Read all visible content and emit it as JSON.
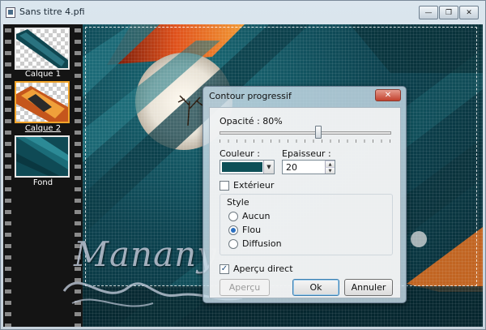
{
  "window": {
    "title": "Sans titre 4.pfi",
    "buttons": {
      "minimize": "—",
      "restore": "❐",
      "close": "✕"
    }
  },
  "layers": [
    {
      "label": "Calque 1",
      "selected": false
    },
    {
      "label": "Calque 2",
      "selected": true
    },
    {
      "label": "Fond",
      "selected": false
    }
  ],
  "dialog": {
    "title": "Contour progressif",
    "close_glyph": "✕",
    "opacity_label": "Opacité : 80%",
    "opacity_value": 80,
    "color_label": "Couleur :",
    "color_value": "#0d4f57",
    "thickness_label": "Epaisseur :",
    "thickness_value": "20",
    "exterior_label": "Extérieur",
    "exterior_checked": false,
    "style_group_label": "Style",
    "style_options": [
      {
        "label": "Aucun",
        "checked": false
      },
      {
        "label": "Flou",
        "checked": true
      },
      {
        "label": "Diffusion",
        "checked": false
      }
    ],
    "preview_label": "Aperçu direct",
    "preview_checked": true,
    "buttons": {
      "preview": "Aperçu",
      "ok": "Ok",
      "cancel": "Annuler"
    }
  },
  "watermark": "Manany",
  "colors": {
    "canvas_dark": "#0c3f4a",
    "accent_orange": "#f1a42b",
    "selection": "#f1a42b"
  }
}
